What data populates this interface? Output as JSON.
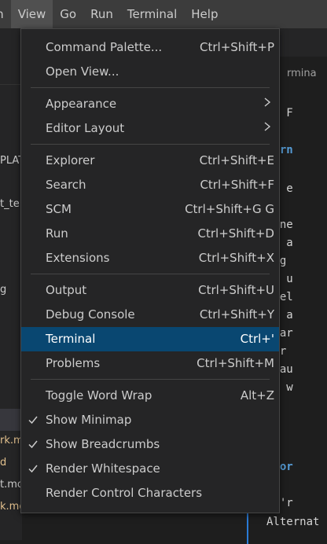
{
  "menubar": {
    "items": [
      "on",
      "View",
      "Go",
      "Run",
      "Terminal",
      "Help"
    ]
  },
  "background": {
    "sidebar_fragments": [
      "PLAT",
      "t_te",
      "g",
      "rk.m",
      "d",
      "t.mo",
      "k.mo"
    ],
    "breadcrumb": "rmina",
    "editor_lines": [
      "rt F",
      "earn",
      "he e",
      "fine",
      "en a",
      "ing",
      "ve u",
      "ncel",
      "ew a",
      "e ar",
      "ear",
      "e au",
      "nd w",
      "efor",
      "ou'r",
      "Alternat"
    ]
  },
  "menu": {
    "groups": [
      [
        {
          "label": "Command Palette...",
          "shortcut": "Ctrl+Shift+P"
        },
        {
          "label": "Open View...",
          "shortcut": ""
        }
      ],
      [
        {
          "label": "Appearance",
          "shortcut": "",
          "submenu": true
        },
        {
          "label": "Editor Layout",
          "shortcut": "",
          "submenu": true
        }
      ],
      [
        {
          "label": "Explorer",
          "shortcut": "Ctrl+Shift+E"
        },
        {
          "label": "Search",
          "shortcut": "Ctrl+Shift+F"
        },
        {
          "label": "SCM",
          "shortcut": "Ctrl+Shift+G G"
        },
        {
          "label": "Run",
          "shortcut": "Ctrl+Shift+D"
        },
        {
          "label": "Extensions",
          "shortcut": "Ctrl+Shift+X"
        }
      ],
      [
        {
          "label": "Output",
          "shortcut": "Ctrl+Shift+U"
        },
        {
          "label": "Debug Console",
          "shortcut": "Ctrl+Shift+Y"
        },
        {
          "label": "Terminal",
          "shortcut": "Ctrl+'",
          "selected": true
        },
        {
          "label": "Problems",
          "shortcut": "Ctrl+Shift+M"
        }
      ],
      [
        {
          "label": "Toggle Word Wrap",
          "shortcut": "Alt+Z"
        },
        {
          "label": "Show Minimap",
          "shortcut": "",
          "checked": true
        },
        {
          "label": "Show Breadcrumbs",
          "shortcut": "",
          "checked": true
        },
        {
          "label": "Render Whitespace",
          "shortcut": "",
          "checked": true
        },
        {
          "label": "Render Control Characters",
          "shortcut": ""
        }
      ]
    ]
  },
  "colors": {
    "menubar_bg": "#3c3c3c",
    "menu_bg": "#252526",
    "selected_bg": "#094771",
    "text": "#cccccc"
  }
}
